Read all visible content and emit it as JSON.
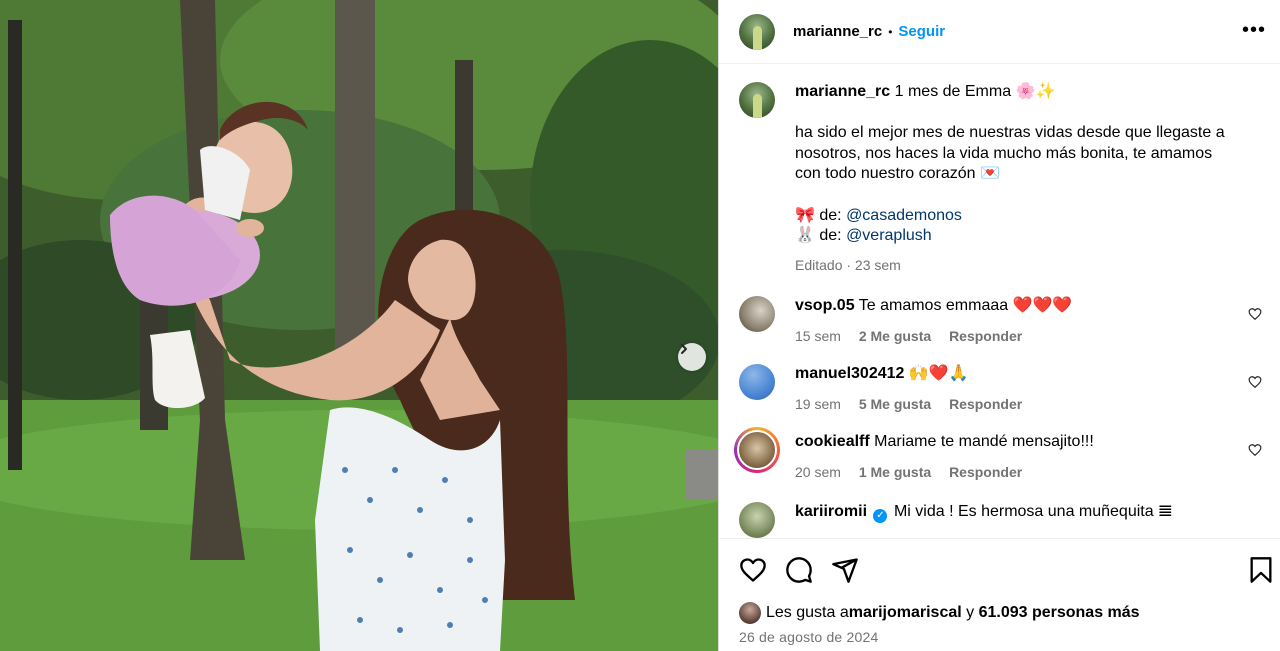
{
  "post": {
    "author": "marianne_rc",
    "follow_label": "Seguir",
    "separator": "•",
    "more_label": "•••"
  },
  "caption": {
    "username": "marianne_rc",
    "title": "1 mes de Emma 🌸✨",
    "paragraph": "ha sido el mejor mes de nuestras vidas desde que llegaste a nosotros, nos haces la vida mucho más bonita, te amamos con todo nuestro corazón 💌",
    "credit1_prefix": "🎀 de: ",
    "credit1_mention": "@casademonos",
    "credit2_prefix": "🐰 de: ",
    "credit2_mention": "@veraplush",
    "meta": "Editado · 23 sem"
  },
  "comments": [
    {
      "username": "vsop.05",
      "text": "Te amamos emmaaa ❤️❤️❤️",
      "time": "15 sem",
      "likes": "2 Me gusta",
      "reply": "Responder"
    },
    {
      "username": "manuel302412",
      "text": "🙌❤️🙏",
      "time": "19 sem",
      "likes": "5 Me gusta",
      "reply": "Responder"
    },
    {
      "username": "cookiealff",
      "text": "Mariame te mandé mensajito!!!",
      "time": "20 sem",
      "likes": "1 Me gusta",
      "reply": "Responder"
    },
    {
      "username": "kariiromii",
      "text": "Mi vida ! Es hermosa una muñequita 𝌆",
      "verified_mark": "✓"
    }
  ],
  "likes": {
    "prefix": "Les gusta a ",
    "user": "marijomariscal",
    "middle": " y ",
    "count": "61.093 personas más"
  },
  "date": "26 de agosto de 2024",
  "icons": [
    "heart-icon",
    "comment-icon",
    "share-icon",
    "bookmark-icon",
    "chevron-right-icon",
    "more-icon"
  ],
  "colors": {
    "follow": "#0095f6",
    "mention": "#00376b",
    "muted": "#737373"
  }
}
